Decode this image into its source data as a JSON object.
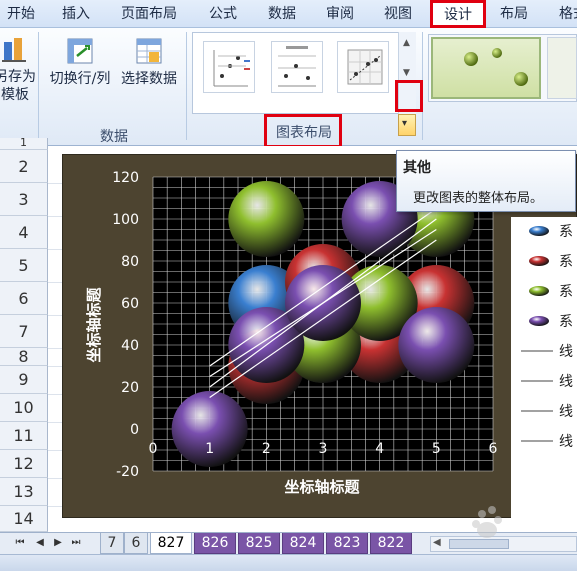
{
  "ribbon_tabs": [
    "开始",
    "插入",
    "页面布局",
    "公式",
    "数据",
    "审阅",
    "视图",
    "设计",
    "布局",
    "格式"
  ],
  "active_tab": "设计",
  "ribbon": {
    "save_template": {
      "line1": "另存为",
      "line2": "模板"
    },
    "switch_row_col": "切换行/列",
    "select_data": "选择数据",
    "data_group": "数据",
    "chart_layout_group": "图表布局"
  },
  "tooltip": {
    "title": "其他",
    "description": "更改图表的整体布局。"
  },
  "row_numbers": [
    "1",
    "2",
    "3",
    "4",
    "5",
    "6",
    "7",
    "8",
    "9",
    "10",
    "11",
    "12",
    "13",
    "14"
  ],
  "chart_data": {
    "type": "scatter",
    "subtype": "bubble-3d",
    "xlabel": "坐标轴标题",
    "ylabel": "坐标轴标题",
    "xlim": [
      0,
      6
    ],
    "ylim": [
      -20,
      120
    ],
    "x_ticks": [
      "0",
      "1",
      "2",
      "3",
      "4",
      "5",
      "6"
    ],
    "y_ticks": [
      "-20",
      "0",
      "20",
      "40",
      "60",
      "80",
      "100",
      "120"
    ],
    "grid": true,
    "legend_position": "right",
    "series": [
      {
        "color": "#3a7fd0",
        "points": [
          [
            2,
            60
          ],
          [
            3,
            40
          ]
        ]
      },
      {
        "color": "#c83232",
        "points": [
          [
            2,
            30
          ],
          [
            3,
            70
          ],
          [
            4,
            40
          ],
          [
            5,
            60
          ]
        ]
      },
      {
        "color": "#8fbf2e",
        "points": [
          [
            2,
            100
          ],
          [
            3,
            40
          ],
          [
            4,
            60
          ],
          [
            5,
            100
          ]
        ]
      },
      {
        "color": "#7a4fb0",
        "points": [
          [
            1,
            0
          ],
          [
            2,
            40
          ],
          [
            3,
            60
          ],
          [
            4,
            100
          ],
          [
            5,
            40
          ]
        ]
      }
    ],
    "trendlines": [
      {
        "from": [
          1,
          20
        ],
        "to": [
          5,
          100
        ]
      },
      {
        "from": [
          1,
          25
        ],
        "to": [
          5,
          95
        ]
      },
      {
        "from": [
          1,
          15
        ],
        "to": [
          5,
          90
        ]
      },
      {
        "from": [
          1,
          30
        ],
        "to": [
          5,
          105
        ]
      }
    ],
    "legend_entries": [
      "系",
      "系",
      "系",
      "系",
      "线",
      "线",
      "线",
      "线"
    ]
  },
  "sheet_tabs": [
    "7",
    "6",
    "827",
    "826",
    "825",
    "824",
    "823",
    "822"
  ],
  "active_sheet": "827",
  "colors": {
    "accent_red": "#e00010",
    "chart_bg": "#4d4430",
    "plot_bg": "#000000",
    "sheet_tab_purple": "#7a55a6"
  }
}
